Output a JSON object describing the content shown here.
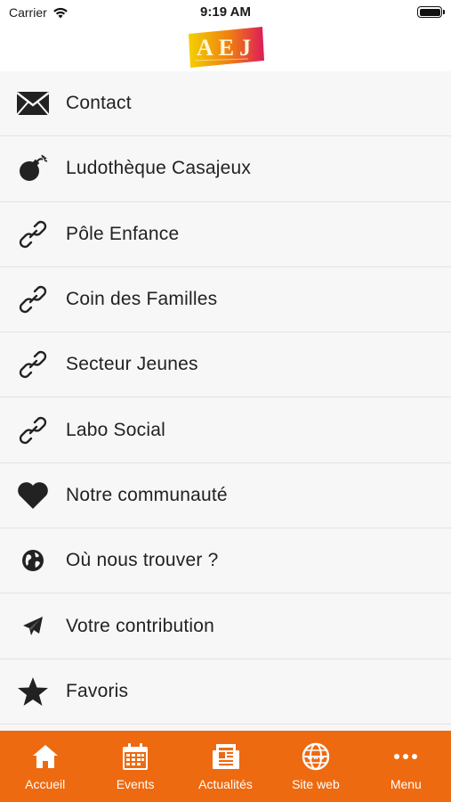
{
  "status_bar": {
    "carrier": "Carrier",
    "time": "9:19 AM"
  },
  "header": {
    "logo_text": "AEJ",
    "logo_colors": [
      "#f2c400",
      "#e84a1a",
      "#d81b5c"
    ]
  },
  "menu": {
    "items": [
      {
        "label": "Contact",
        "icon": "envelope-icon"
      },
      {
        "label": "Ludothèque Casajeux",
        "icon": "bomb-icon"
      },
      {
        "label": "Pôle Enfance",
        "icon": "link-icon"
      },
      {
        "label": "Coin des Familles",
        "icon": "link-icon"
      },
      {
        "label": "Secteur Jeunes",
        "icon": "link-icon"
      },
      {
        "label": "Labo Social",
        "icon": "link-icon"
      },
      {
        "label": "Notre communauté",
        "icon": "heart-icon"
      },
      {
        "label": "Où nous trouver ?",
        "icon": "globe-icon"
      },
      {
        "label": "Votre contribution",
        "icon": "paper-plane-icon"
      },
      {
        "label": "Favoris",
        "icon": "star-icon"
      }
    ]
  },
  "tab_bar": {
    "accent_color": "#ee6a10",
    "tabs": [
      {
        "label": "Accueil",
        "icon": "home-icon"
      },
      {
        "label": "Events",
        "icon": "calendar-icon"
      },
      {
        "label": "Actualités",
        "icon": "newspaper-icon"
      },
      {
        "label": "Site web",
        "icon": "web-globe-icon"
      },
      {
        "label": "Menu",
        "icon": "more-icon"
      }
    ]
  }
}
